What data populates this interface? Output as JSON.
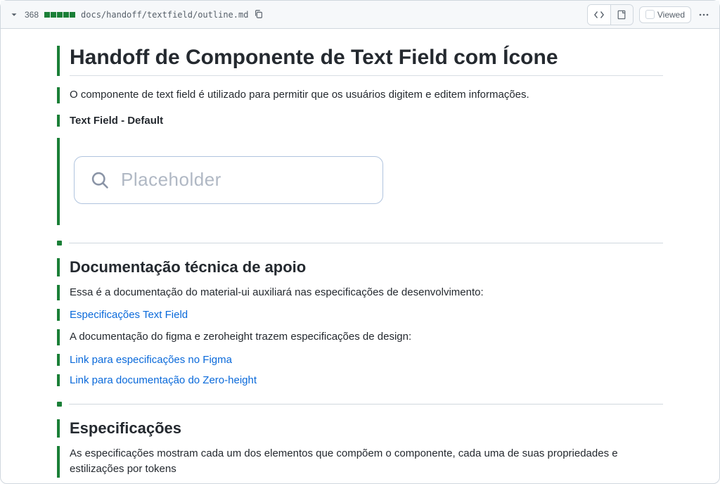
{
  "header": {
    "line_count": "368",
    "filepath": "docs/handoff/textfield/outline.md",
    "viewed_label": "Viewed"
  },
  "doc": {
    "title": "Handoff de Componente de Text Field com Ícone",
    "intro": "O componente de text field é utilizado para permitir que os usuários digitem e editem informações.",
    "variant_label": "Text Field - Default",
    "textfield": {
      "placeholder": "Placeholder"
    },
    "tech_heading": "Documentação técnica de apoio",
    "tech_para1": "Essa é a documentação do material-ui auxiliará nas especificações de desenvolvimento:",
    "tech_link1": "Especificações Text Field",
    "tech_para2": "A documentação do figma e zeroheight trazem especificações de design:",
    "tech_link2": "Link para especificações no Figma",
    "tech_link3": "Link para documentação do Zero-height",
    "spec_heading": "Especificações",
    "spec_para": "As especificações mostram cada um dos elementos que compõem o componente, cada uma de suas propriedades e estilizações por tokens"
  }
}
